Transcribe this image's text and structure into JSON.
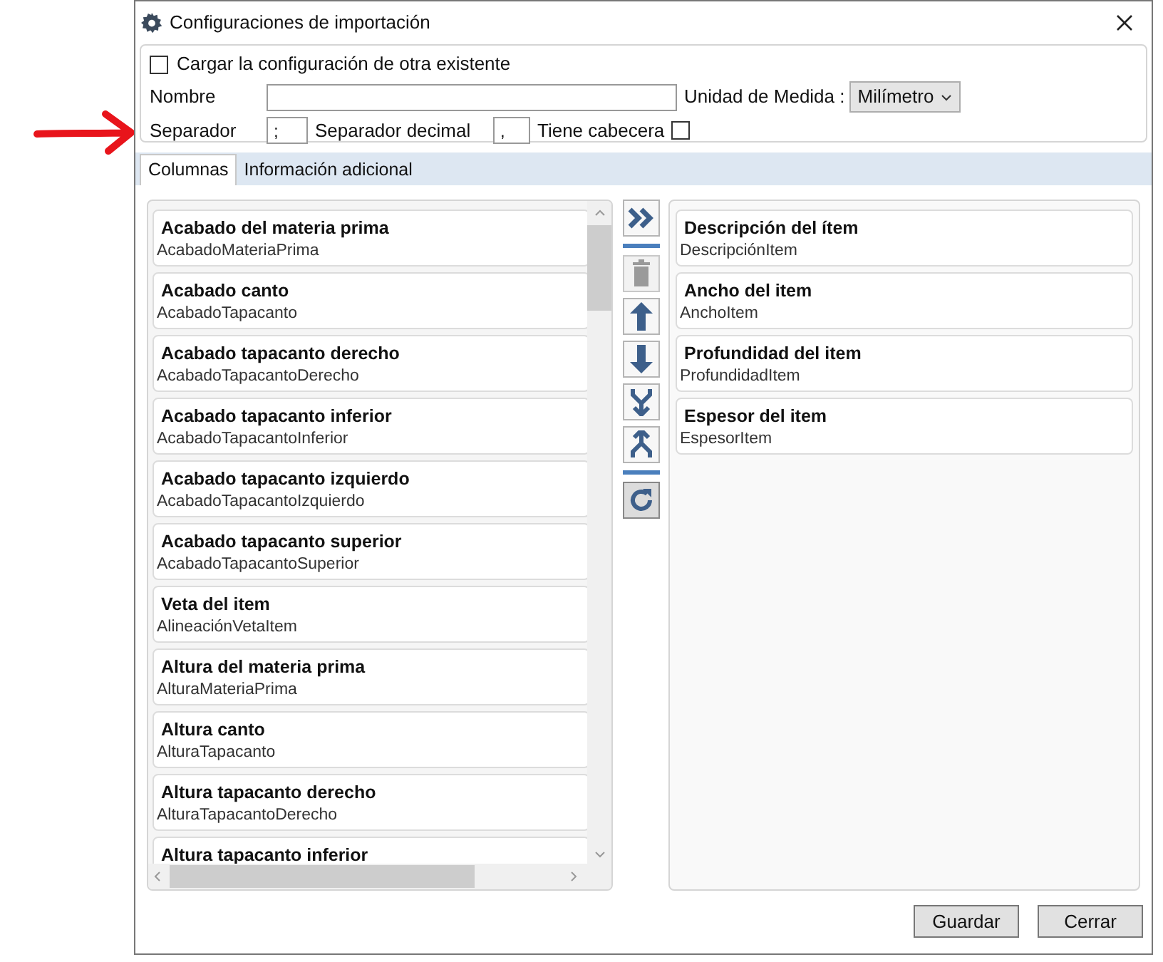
{
  "window": {
    "title": "Configuraciones de importación"
  },
  "settings": {
    "load_existing": {
      "label": "Cargar la configuración de otra existente",
      "checked": false
    },
    "name": {
      "label": "Nombre"
    },
    "unit": {
      "label": "Unidad de Medida :",
      "value": "Milímetro"
    },
    "separator": {
      "label": "Separador",
      "value": ";"
    },
    "decimal_separator": {
      "label": "Separador decimal",
      "value": ","
    },
    "has_header": {
      "label": "Tiene cabecera",
      "checked": false
    }
  },
  "tabs": [
    {
      "label": "Columnas",
      "selected": true
    },
    {
      "label": "Información adicional",
      "selected": false
    }
  ],
  "available_columns": [
    {
      "title": "Acabado del materia prima",
      "field": "AcabadoMateriaPrima"
    },
    {
      "title": "Acabado canto",
      "field": "AcabadoTapacanto"
    },
    {
      "title": "Acabado tapacanto derecho",
      "field": "AcabadoTapacantoDerecho"
    },
    {
      "title": "Acabado tapacanto inferior",
      "field": "AcabadoTapacantoInferior"
    },
    {
      "title": "Acabado tapacanto izquierdo",
      "field": "AcabadoTapacantoIzquierdo"
    },
    {
      "title": "Acabado tapacanto superior",
      "field": "AcabadoTapacantoSuperior"
    },
    {
      "title": "Veta del item",
      "field": "AlineaciónVetaItem"
    },
    {
      "title": "Altura del materia prima",
      "field": "AlturaMateriaPrima"
    },
    {
      "title": "Altura canto",
      "field": "AlturaTapacanto"
    },
    {
      "title": "Altura tapacanto derecho",
      "field": "AlturaTapacantoDerecho"
    },
    {
      "title": "Altura tapacanto inferior"
    }
  ],
  "tools": [
    {
      "kind": "add",
      "disabled": false
    },
    {
      "kind": "separator"
    },
    {
      "kind": "delete",
      "disabled": true
    },
    {
      "kind": "up",
      "disabled": false
    },
    {
      "kind": "down",
      "disabled": false
    },
    {
      "kind": "merge",
      "disabled": false
    },
    {
      "kind": "split",
      "disabled": false
    },
    {
      "kind": "separator"
    },
    {
      "kind": "reset",
      "disabled": false
    }
  ],
  "selected_columns": [
    {
      "title": "Descripción del ítem",
      "field": "DescripciónItem"
    },
    {
      "title": "Ancho del item",
      "field": "AnchoItem"
    },
    {
      "title": "Profundidad del item",
      "field": "ProfundidadItem"
    },
    {
      "title": "Espesor del item",
      "field": "EspesorItem"
    }
  ],
  "buttons": [
    {
      "label": "Guardar"
    },
    {
      "label": "Cerrar"
    }
  ]
}
